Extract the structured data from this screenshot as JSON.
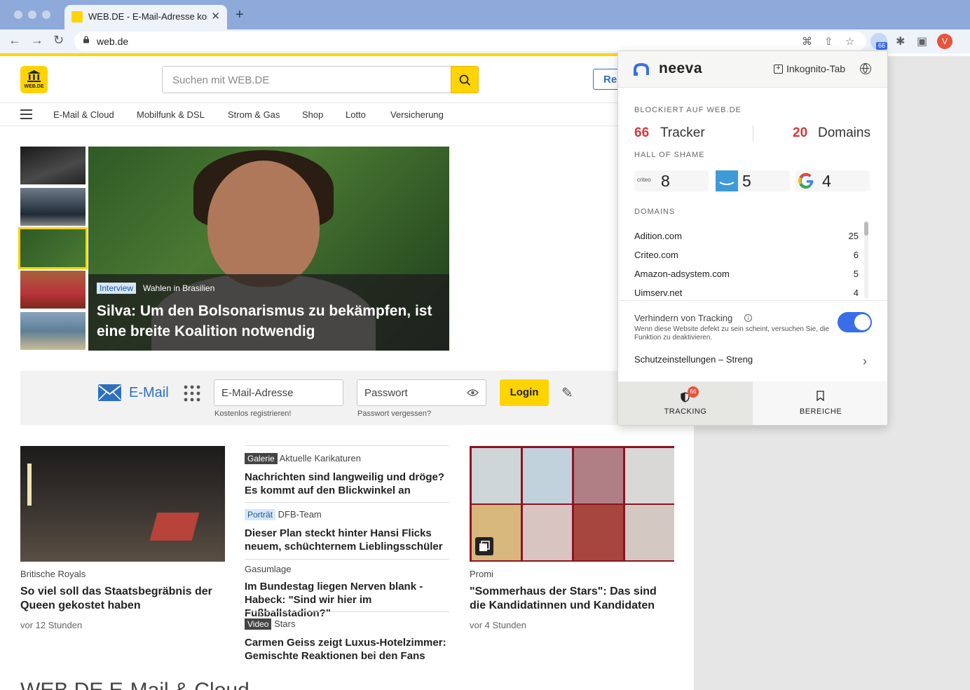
{
  "browser": {
    "tab_title": "WEB.DE - E-Mail-Adresse kostenlos",
    "tab_close": "✕",
    "new_tab": "+",
    "url": "web.de",
    "avatar_letter": "V",
    "extension_badge": "66",
    "nav_back": "←",
    "nav_forward": "→",
    "nav_reload": "↻",
    "icons": {
      "translate": "⌘",
      "share": "⇧",
      "star": "☆",
      "puzzle": "✱",
      "sidepanel": "▣"
    }
  },
  "site": {
    "logo_text": "WEB.DE",
    "search_placeholder": "Suchen mit WEB.DE",
    "register_label": "Re",
    "nav": [
      "E-Mail & Cloud",
      "Mobilfunk & DSL",
      "Strom & Gas",
      "Shop",
      "Lotto",
      "Versicherung"
    ],
    "hero": {
      "tag": "Interview",
      "kicker": "Wahlen in Brasilien",
      "title": "Silva: Um den Bolsonarismus zu bekämpfen, ist eine breite Koalition notwendig"
    },
    "mail": {
      "label": "E-Mail",
      "email_placeholder": "E-Mail-Adresse",
      "password_placeholder": "Passwort",
      "register_link": "Kostenlos registrieren!",
      "forgot_link": "Passwort vergessen?",
      "login_label": "Login"
    },
    "card_left": {
      "kicker": "Britische Royals",
      "headline": "So viel soll das Staatsbegräbnis der Queen gekostet haben",
      "time": "vor 12 Stunden"
    },
    "list": [
      {
        "tag": "Galerie",
        "tag_style": "dark",
        "kicker": "Aktuelle Karikaturen",
        "headline": "Nachrichten sind langweilig und dröge? Es kommt auf den Blickwinkel an"
      },
      {
        "tag": "Porträt",
        "tag_style": "light",
        "kicker": "DFB-Team",
        "headline": "Dieser Plan steckt hinter Hansi Flicks neuem, schüchternem Lieblingsschüler"
      },
      {
        "tag": "",
        "tag_style": "none",
        "kicker": "Gasumlage",
        "headline": "Im Bundestag liegen Nerven blank - Habeck: \"Sind wir hier im Fußballstadion?\""
      },
      {
        "tag": "Video",
        "tag_style": "dark",
        "kicker": "Stars",
        "headline": "Carmen Geiss zeigt Luxus-Hotelzimmer: Gemischte Reaktionen bei den Fans"
      }
    ],
    "card_right": {
      "kicker": "Promi",
      "headline": "\"Sommerhaus der Stars\": Das sind die Kandidatinnen und Kandidaten",
      "time": "vor 4 Stunden"
    },
    "bottom_title": "WEB.DE E-Mail & Cloud"
  },
  "neeva": {
    "brand": "neeva",
    "incognito_label": "Inkognito-Tab",
    "blocked_label": "BLOCKIERT AUF WEB.DE",
    "tracker_count": "66",
    "tracker_label": "Tracker",
    "domain_count": "20",
    "domain_label": "Domains",
    "hall_label": "HALL OF SHAME",
    "hall": [
      {
        "name": "criteo",
        "count": "8"
      },
      {
        "name": "amazon",
        "count": "5"
      },
      {
        "name": "google",
        "count": "4"
      }
    ],
    "domains_label": "DOMAINS",
    "domains": [
      {
        "name": "Adition.com",
        "count": "25"
      },
      {
        "name": "Criteo.com",
        "count": "6"
      },
      {
        "name": "Amazon-adsystem.com",
        "count": "5"
      },
      {
        "name": "Uimserv.net",
        "count": "4"
      }
    ],
    "prevent_title": "Verhindern von Tracking",
    "prevent_desc": "Wenn diese Website defekt zu sein scheint, versuchen Sie, die Funktion zu deaktivieren.",
    "protection_label": "Schutzeinstellungen – Streng",
    "tab_tracking": "TRACKING",
    "tab_tracking_badge": "66",
    "tab_areas": "BEREICHE",
    "chevron": "›",
    "info": "i"
  },
  "colors": {
    "accent_yellow": "#ffd400",
    "webde_blue": "#2e6fc0",
    "neeva_red": "#d6383a",
    "toggle_blue": "#3a6ee8"
  }
}
